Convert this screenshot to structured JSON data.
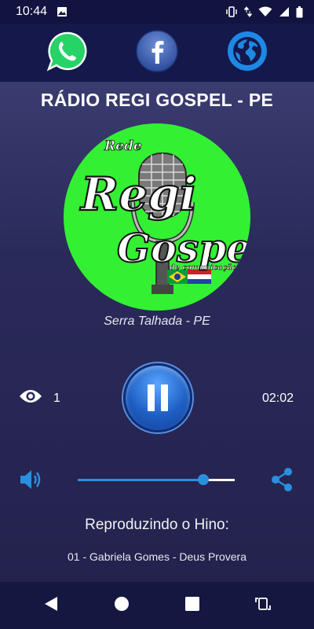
{
  "status_bar": {
    "time": "10:44",
    "icons": [
      "image-notification-icon",
      "vibrate-icon",
      "data-arrows-icon",
      "wifi-icon",
      "signal-icon",
      "battery-icon"
    ]
  },
  "social": {
    "items": [
      {
        "name": "whatsapp",
        "icon": "whatsapp-icon",
        "color": "#25d366"
      },
      {
        "name": "facebook",
        "icon": "facebook-icon",
        "color": "#3b5998"
      },
      {
        "name": "website",
        "icon": "globe-icon",
        "color": "#1e88e5"
      }
    ]
  },
  "station": {
    "title": "RÁDIO REGI GOSPEL - PE",
    "location": "Serra Talhada - PE",
    "logo": {
      "line1": "Rede",
      "line2": "Regi",
      "line3": "Gospel",
      "line4": "de comunicação",
      "background": "#33f033"
    }
  },
  "player": {
    "listeners_icon": "eye-icon",
    "listeners_count": "1",
    "state": "playing",
    "elapsed": "02:02",
    "volume_level": 0.8,
    "accent": "#2b8fe0"
  },
  "now_playing": {
    "label": "Reproduzindo o Hino:",
    "track": "01 - Gabriela Gomes - Deus Provera"
  },
  "nav_bar": {
    "buttons": [
      "back-icon",
      "home-icon",
      "recents-icon",
      "rotate-icon"
    ]
  }
}
